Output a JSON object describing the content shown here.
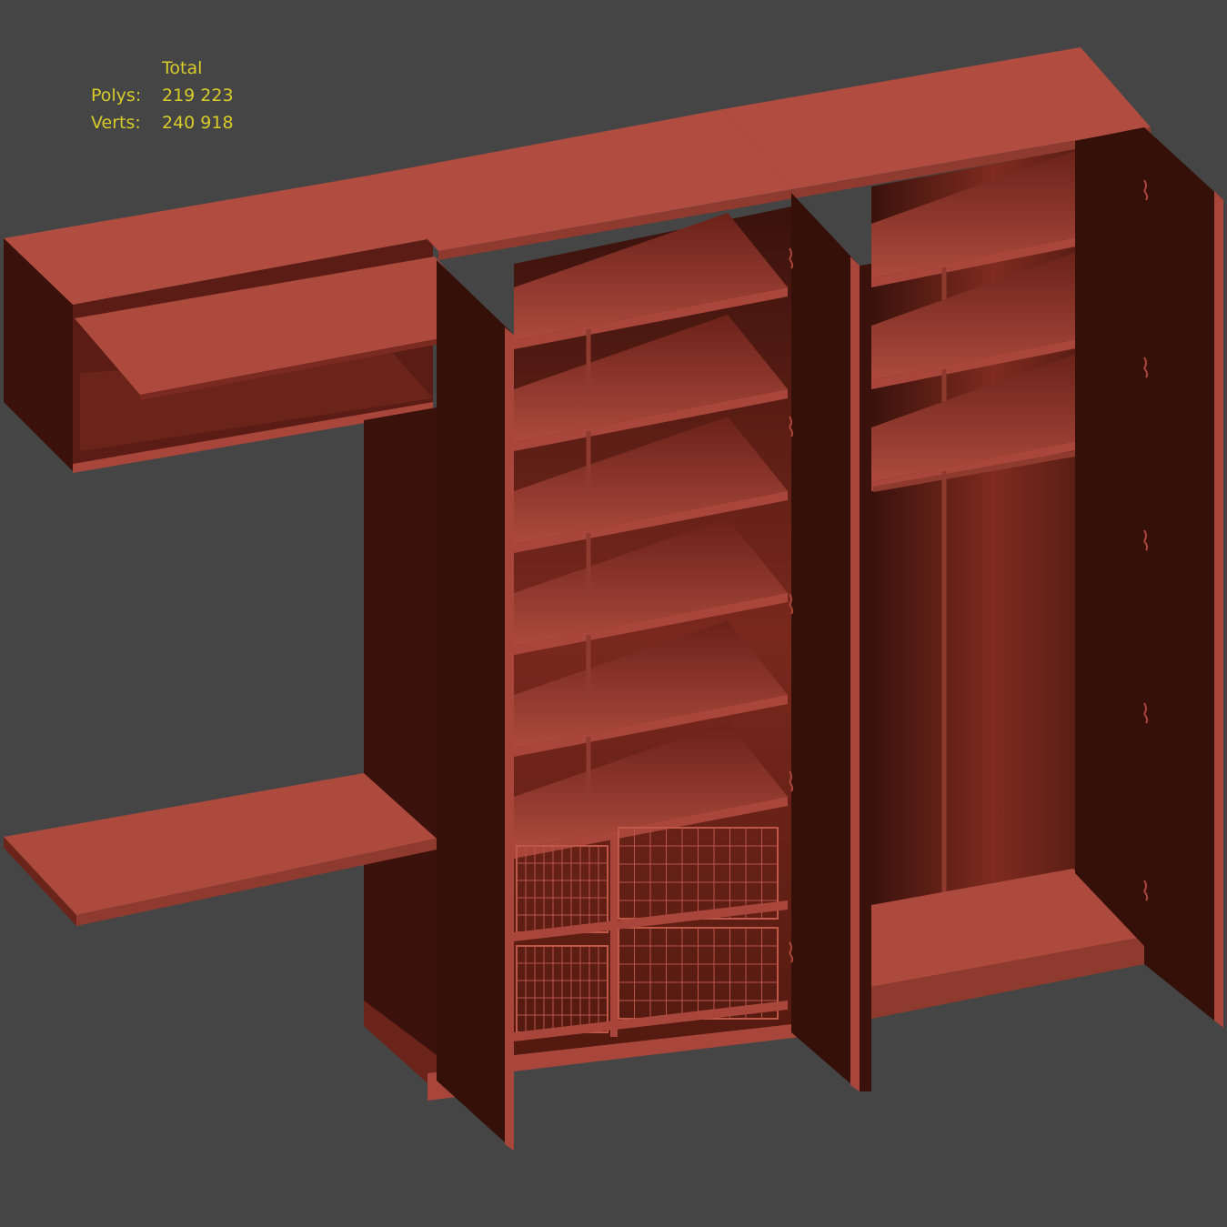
{
  "viewport": {
    "background": "#454545",
    "stats": {
      "header": "Total",
      "polys_label": "Polys:",
      "polys_value": "219 223",
      "verts_label": "Verts:",
      "verts_value": "240 918",
      "text_color": "#d8cc2a"
    }
  },
  "model": {
    "colors": {
      "top": "#b04c40",
      "top_dark": "#9c4035",
      "front": "#a8463b",
      "dark": "#341009",
      "interior": "#6e2218",
      "back_glow": "#7d2a1e"
    }
  }
}
